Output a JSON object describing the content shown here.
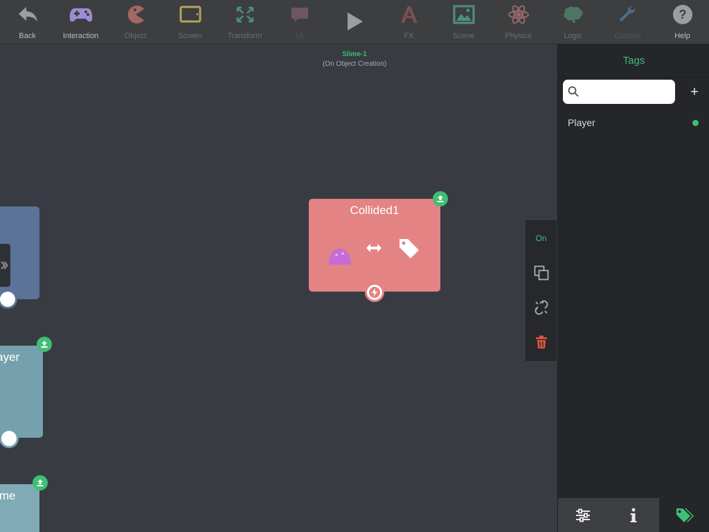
{
  "colors": {
    "accent_green": "#3fbf74",
    "icon_gray": "#9b9da1",
    "label_gray": "#b9bbbf",
    "disabled": "#6c6d70",
    "interaction": "#9d8cd3",
    "object": "#a26763",
    "screen": "#b4a25e",
    "transform": "#4b8f86",
    "ui": "#6f5560",
    "fx": "#7e4e4f",
    "scene": "#4e9180",
    "physics": "#96686e",
    "logic": "#4f7463",
    "custom": "#4e6c89",
    "node_red": "#e38383",
    "node_blue": "#5b7299",
    "node_teal": "#74a1ad",
    "node_teal2": "#7faab6",
    "delete_red": "#e4553f"
  },
  "toolbar": {
    "items": [
      {
        "label": "Back",
        "icon": "back-arrow-icon"
      },
      {
        "label": "Interaction",
        "icon": "gamepad-icon"
      },
      {
        "label": "Object",
        "icon": "pacman-icon"
      },
      {
        "label": "Screen",
        "icon": "tablet-screen-icon"
      },
      {
        "label": "Transform",
        "icon": "expand-arrows-icon"
      },
      {
        "label": "UI",
        "icon": "speech-bubble-icon"
      },
      {
        "label": "Play",
        "icon": "play-icon"
      },
      {
        "label": "FX",
        "icon": "fx-icon"
      },
      {
        "label": "Scene",
        "icon": "image-icon"
      },
      {
        "label": "Physics",
        "icon": "atom-icon"
      },
      {
        "label": "Logic",
        "icon": "brain-icon"
      },
      {
        "label": "Custom",
        "icon": "wrench-icon"
      },
      {
        "label": "Help",
        "icon": "help-icon"
      }
    ]
  },
  "canvas": {
    "object_title": "Slime-1",
    "object_subtitle": "(On Object Creation)",
    "main_node": {
      "title": "Collided1"
    },
    "left_nodes": [
      {
        "title": ""
      },
      {
        "title": "Player"
      },
      {
        "title": "Slime"
      }
    ]
  },
  "side_panel": {
    "on_label": "On",
    "icons": [
      "copy-icon",
      "unlink-icon",
      "trash-icon"
    ]
  },
  "tags_panel": {
    "title": "Tags",
    "search_placeholder": "",
    "search_value": "",
    "add_label": "+",
    "tags": [
      {
        "label": "Player",
        "status": "active"
      }
    ],
    "footer_tabs": [
      "sliders-icon",
      "info-icon",
      "tags-icon"
    ]
  }
}
